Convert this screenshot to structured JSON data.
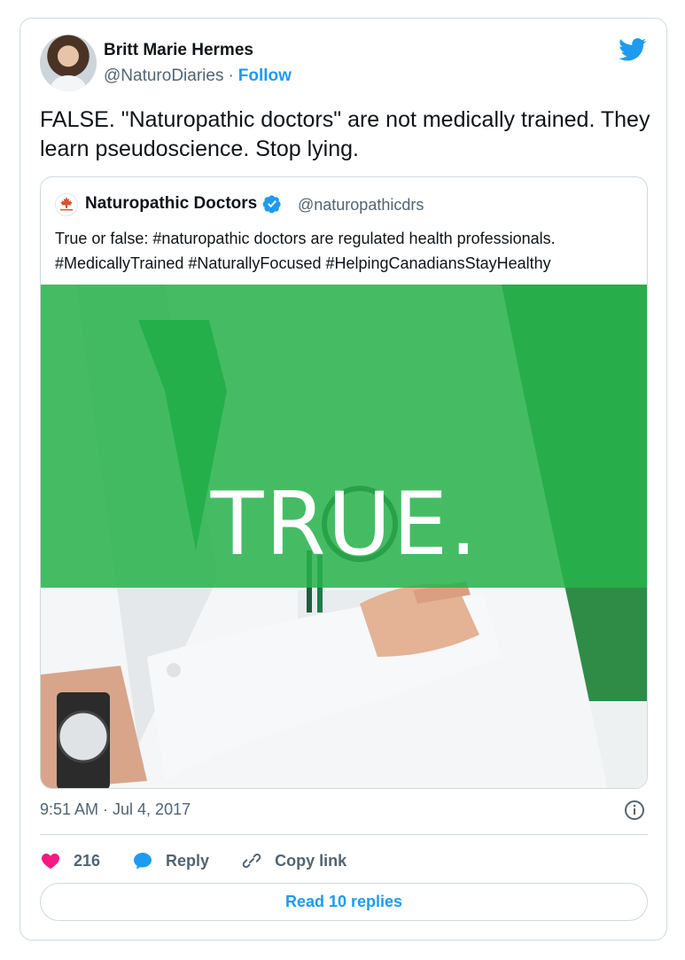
{
  "author": {
    "name": "Britt Marie Hermes",
    "handle": "@NaturoDiaries",
    "separator": "·",
    "follow_label": "Follow"
  },
  "tweet": {
    "text": "FALSE. \"Naturopathic doctors\" are not medically trained. They learn pseudoscience. Stop lying."
  },
  "quoted_tweet": {
    "name": "Naturopathic Doctors",
    "handle": "@naturopathicdrs",
    "text_line1": "True or false: #naturopathic doctors are regulated health professionals.",
    "text_line2": "#MedicallyTrained #NaturallyFocused #HelpingCanadiansStayHealthy",
    "media_overlay_text": "TRUE.",
    "overlay_color": "#28b24c"
  },
  "meta": {
    "timestamp": "9:51 AM · Jul 4, 2017"
  },
  "actions": {
    "like_count": "216",
    "reply_label": "Reply",
    "copy_link_label": "Copy link"
  },
  "read_replies_label": "Read 10 replies",
  "colors": {
    "accent": "#1d9bf0",
    "like": "#f91880",
    "text_primary": "#0f1419",
    "text_secondary": "#536471",
    "border": "#cfd9de"
  },
  "icons": {
    "brand": "twitter-bird-icon",
    "verified": "verified-badge-icon",
    "info": "info-icon",
    "like": "heart-icon",
    "reply": "speech-bubble-icon",
    "copy_link": "link-icon"
  }
}
